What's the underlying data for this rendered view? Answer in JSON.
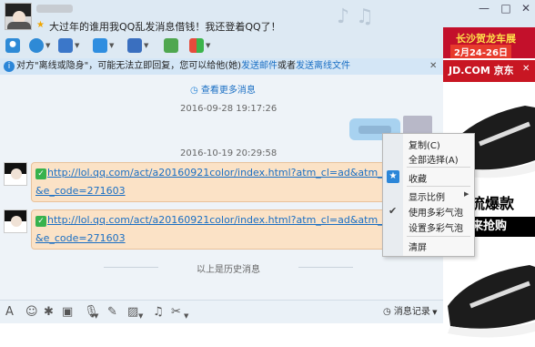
{
  "header": {
    "signature": "大过年的谁用我QQ乱发消息借钱！我还登着QQ了！",
    "window_buttons": [
      "—",
      "□",
      "✕"
    ]
  },
  "notice": {
    "text_prefix": "对方\"离线或隐身\"，可能无法立即回复，您可以给他(她)",
    "link_mail": "发送邮件",
    "text_or": "或者",
    "link_file": "发送离线文件",
    "close": "✕"
  },
  "chat": {
    "more": "查看更多消息",
    "time1": "2016-09-28 19:17:26",
    "time2": "2016-10-19 20:29:58",
    "msg1_line1": "http://lol.qq.com/act/a20160921color/index.html?atm_cl=ad&atm_pos=64",
    "msg1_line2": "&e_code=271603",
    "msg2_line1": "http://lol.qq.com/act/a20160921color/index.html?atm_cl=ad&atm_pos=64",
    "msg2_line2": "&e_code=271603",
    "history": "以上是历史消息"
  },
  "menu": {
    "copy": "复制(C)",
    "select_all": "全部选择(A)",
    "favorite": "收藏",
    "zoom": "显示比例",
    "colorful": "使用多彩气泡",
    "set_colorful": "设置多彩气泡",
    "clear": "清屏"
  },
  "ad": {
    "top_title": "长沙贺龙车展",
    "top_date": "2月24-26日",
    "jd": "JD.COM 京东",
    "slogan": "潮流爆款",
    "cta": "快来抢购"
  },
  "inputbar": {
    "record": "消息记录"
  },
  "colors": {
    "accent_blue": "#2b86d8",
    "bubble": "#fbe2c6",
    "ad_red": "#c3102b"
  }
}
